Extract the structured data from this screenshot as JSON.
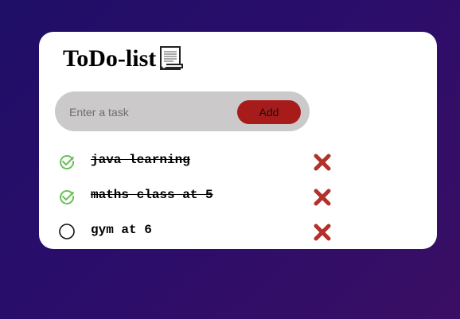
{
  "app": {
    "title": "ToDo-list"
  },
  "form": {
    "placeholder": "Enter a task",
    "add_label": "Add"
  },
  "colors": {
    "accent": "#a81b1b",
    "check": "#6bbf59",
    "delete": "#b3302b",
    "input_bg": "#cbc9c9"
  },
  "tasks": [
    {
      "label": "java learning",
      "done": true
    },
    {
      "label": "maths class at 5",
      "done": true
    },
    {
      "label": "gym at 6",
      "done": false
    }
  ]
}
